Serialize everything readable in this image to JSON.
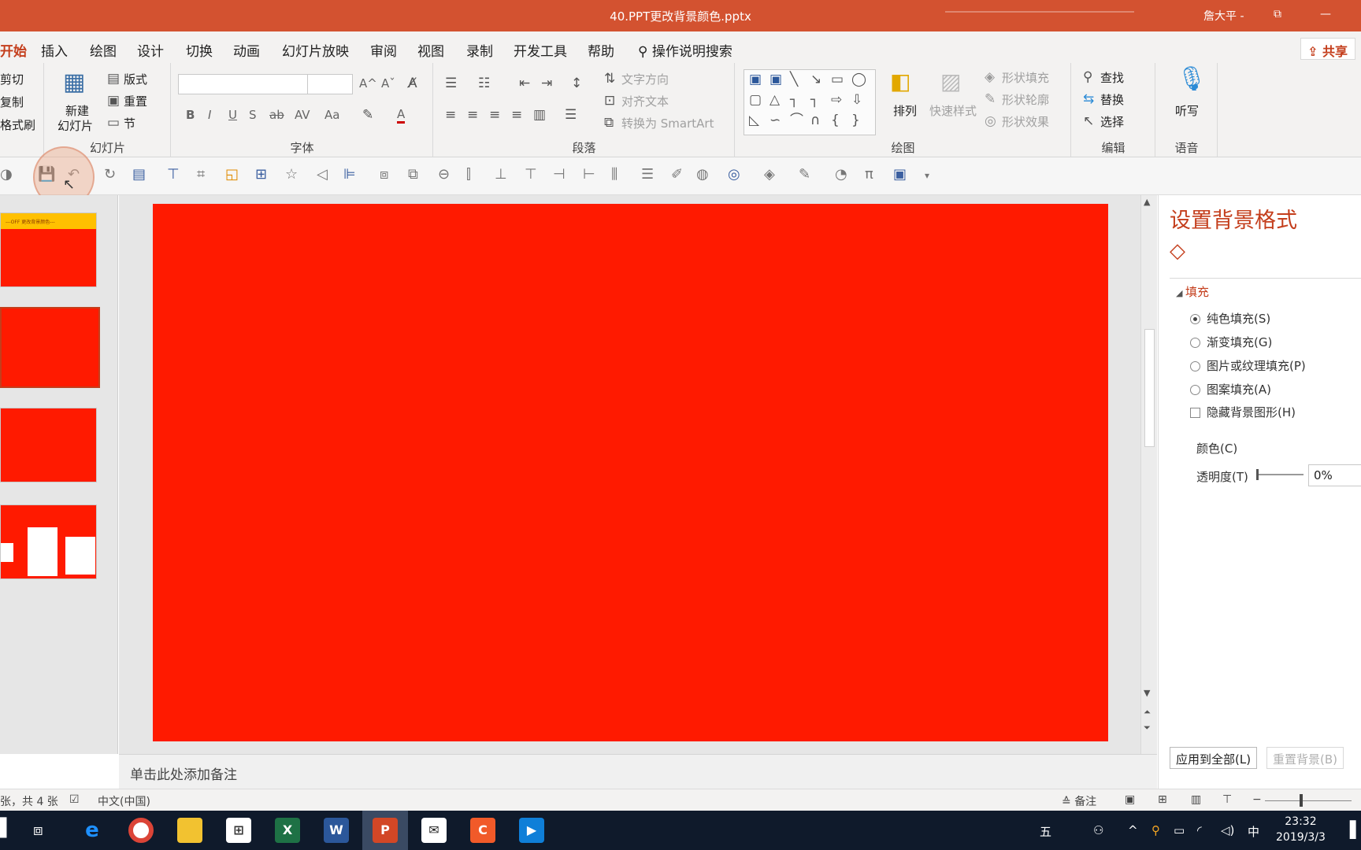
{
  "titlebar": {
    "title": "40.PPT更改背景颜色.pptx",
    "user": "詹大平 -",
    "restore": "⧉",
    "minimize": "—"
  },
  "tabs": [
    "开始",
    "插入",
    "绘图",
    "设计",
    "切换",
    "动画",
    "幻灯片放映",
    "审阅",
    "视图",
    "录制",
    "开发工具",
    "帮助"
  ],
  "search": {
    "label": "操作说明搜索"
  },
  "share": {
    "label": "共享"
  },
  "ribbon": {
    "clipboard": {
      "cut": "剪切",
      "copy": "复制",
      "format_painter": "格式刷"
    },
    "slides": {
      "new_slide_line1": "新建",
      "new_slide_line2": "幻灯片",
      "layout": "版式",
      "reset": "重置",
      "section": "节",
      "label": "幻灯片"
    },
    "font": {
      "label": "字体",
      "bold": "B",
      "italic": "I",
      "underline": "U",
      "shadow": "S",
      "strike": "ab",
      "spacing": "AV",
      "case": "Aa",
      "grow": "A^",
      "shrink": "Aˇ",
      "color": "A"
    },
    "paragraph": {
      "label": "段落",
      "text_direction": "文字方向",
      "align_text": "对齐文本",
      "smartart": "转换为 SmartArt"
    },
    "drawing": {
      "label": "绘图",
      "arrange": "排列",
      "quick_styles": "快速样式",
      "shape_fill": "形状填充",
      "shape_outline": "形状轮廓",
      "shape_effects": "形状效果"
    },
    "editing": {
      "label": "编辑",
      "find": "查找",
      "replace": "替换",
      "select": "选择"
    },
    "voice": {
      "label": "语音",
      "dictate": "听写"
    }
  },
  "thumbs": {
    "thumb1_text": "---OFF 更改背景颜色---"
  },
  "notes": {
    "placeholder": "单击此处添加备注"
  },
  "pane": {
    "title": "设置背景格式",
    "fill_header": "填充",
    "options": [
      "纯色填充(S)",
      "渐变填充(G)",
      "图片或纹理填充(P)",
      "图案填充(A)"
    ],
    "hide_bg": "隐藏背景图形(H)",
    "color_label": "颜色(C)",
    "transparency_label": "透明度(T)",
    "transparency_value": "0%",
    "apply_all": "应用到全部(L)",
    "reset_bg": "重置背景(B)"
  },
  "status": {
    "slide_info": "张，共 4 张",
    "language": "中文(中国)",
    "notes": "备注"
  },
  "taskbar": {
    "clock_time": "23:32",
    "clock_date": "2019/3/3",
    "ime": "中",
    "ime_mode": "五"
  },
  "colors": {
    "accent": "#c43e1c",
    "titlebar": "#d35230",
    "slide": "#ff1a00"
  }
}
